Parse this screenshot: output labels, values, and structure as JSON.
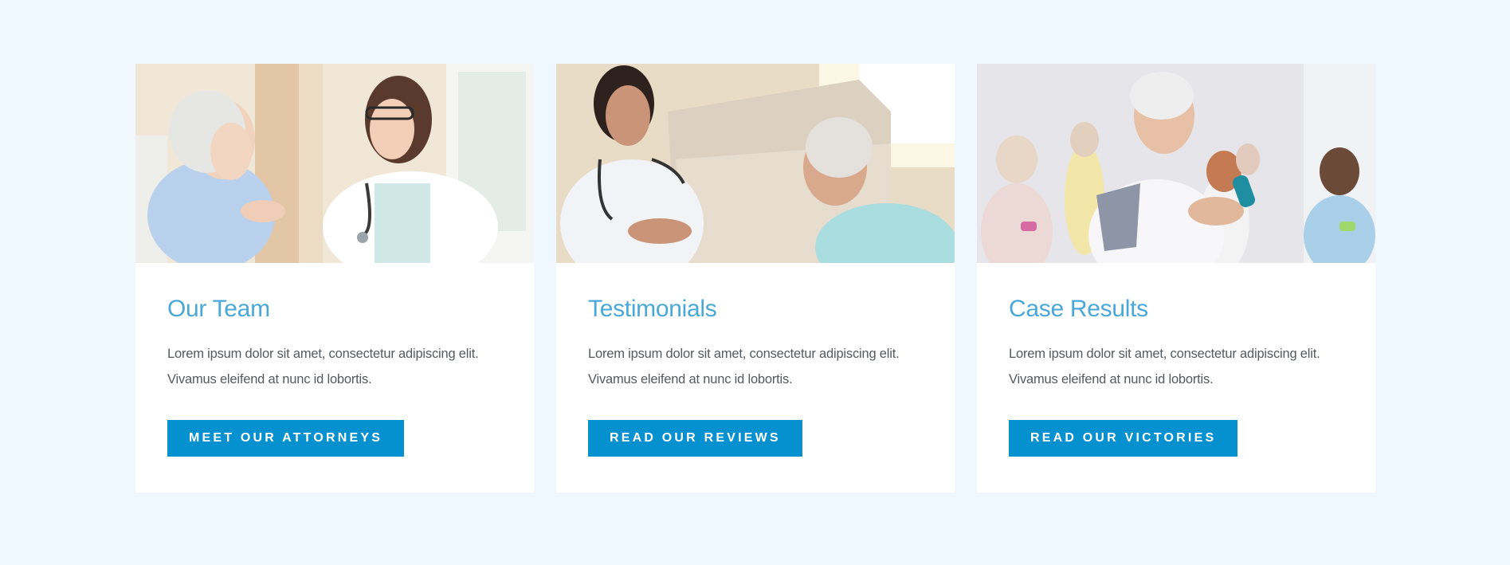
{
  "cards": [
    {
      "image_alt": "Senior woman smiling with young female doctor",
      "title": "Our Team",
      "text_line1": "Lorem ipsum dolor sit amet, consectetur adipiscing elit.",
      "text_line2": "Vivamus eleifend at nunc id lobortis.",
      "button_label": "MEET OUR ATTORNEYS"
    },
    {
      "image_alt": "Female doctor talking with senior man on a sofa",
      "title": "Testimonials",
      "text_line1": "Lorem ipsum dolor sit amet, consectetur adipiscing elit.",
      "text_line2": "Vivamus eleifend at nunc id lobortis.",
      "button_label": "READ OUR REVIEWS"
    },
    {
      "image_alt": "Smiling senior man exercising with dumbbells",
      "title": "Case Results",
      "text_line1": "Lorem ipsum dolor sit amet, consectetur adipiscing elit.",
      "text_line2": "Vivamus eleifend at nunc id lobortis.",
      "button_label": "READ OUR VICTORIES"
    }
  ],
  "colors": {
    "page_background": "#eef8fe",
    "card_background": "#ffffff",
    "title": "#4aa8d8",
    "body_text": "#555a5e",
    "button": "#0590d0",
    "button_text": "#ffffff"
  }
}
